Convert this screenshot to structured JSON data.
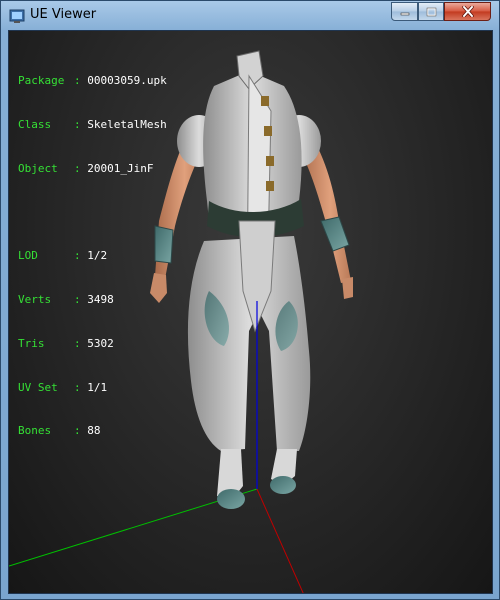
{
  "window": {
    "title": "UE Viewer",
    "icons": [
      "app-icon",
      "minimize-icon",
      "maximize-icon",
      "close-icon"
    ]
  },
  "info": {
    "package": {
      "label": "Package",
      "value": "00003059.upk"
    },
    "class": {
      "label": "Class",
      "value": "SkeletalMesh"
    },
    "object": {
      "label": "Object",
      "value": "20001_JinF"
    },
    "lod": {
      "label": "LOD",
      "value": "1/2"
    },
    "verts": {
      "label": "Verts",
      "value": "3498"
    },
    "tris": {
      "label": "Tris",
      "value": "5302"
    },
    "uvset": {
      "label": "UV Set",
      "value": "1/1"
    },
    "bones": {
      "label": "Bones",
      "value": "88"
    }
  },
  "colors": {
    "label_green": "#35e035",
    "axis_x": "#00c000",
    "axis_y": "#c00000",
    "axis_z": "#0000e0",
    "viewport_bg": "#2a2a2a"
  }
}
